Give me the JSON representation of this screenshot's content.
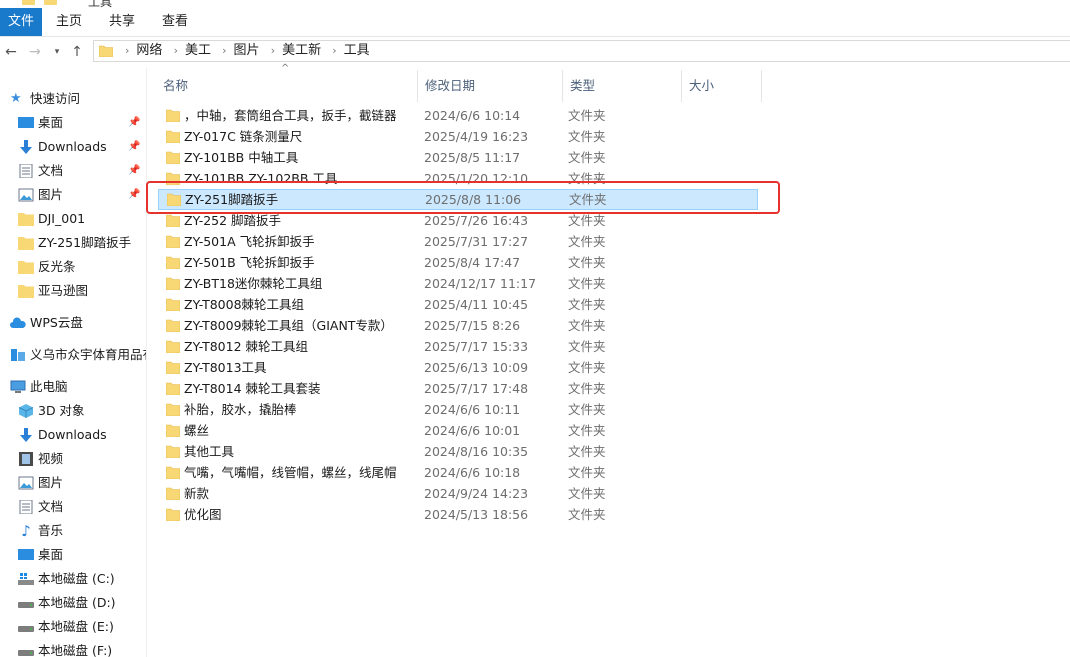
{
  "window": {
    "title": "工具"
  },
  "ribbon": {
    "tabs": [
      "文件",
      "主页",
      "共享",
      "查看"
    ]
  },
  "address": {
    "crumbs": [
      "网络",
      "美工",
      "图片",
      "美工新",
      "工具"
    ]
  },
  "sidebar": {
    "quick_access": "快速访问",
    "pinned": [
      "桌面",
      "Downloads",
      "文档",
      "图片"
    ],
    "recent": [
      "DJI_001",
      "ZY-251脚踏扳手",
      "反光条",
      "亚马逊图"
    ],
    "wps": "WPS云盘",
    "company": "义乌市众宇体育用品有",
    "this_pc": "此电脑",
    "pc_items": [
      "3D 对象",
      "Downloads",
      "视频",
      "图片",
      "文档",
      "音乐",
      "桌面",
      "本地磁盘 (C:)",
      "本地磁盘 (D:)",
      "本地磁盘 (E:)",
      "本地磁盘 (F:)"
    ]
  },
  "columns": {
    "name": "名称",
    "date": "修改日期",
    "type": "类型",
    "size": "大小"
  },
  "files": [
    {
      "name": "，中轴，套筒组合工具，扳手，截链器",
      "date": "2024/6/6 10:14",
      "type": "文件夹"
    },
    {
      "name": "ZY-017C  链条测量尺",
      "date": "2025/4/19 16:23",
      "type": "文件夹"
    },
    {
      "name": "ZY-101BB  中轴工具",
      "date": "2025/8/5 11:17",
      "type": "文件夹"
    },
    {
      "name": "ZY-101BB ZY-102BB  工具",
      "date": "2025/1/20 12:10",
      "type": "文件夹"
    },
    {
      "name": "ZY-251脚踏扳手",
      "date": "2025/8/8 11:06",
      "type": "文件夹",
      "selected": true
    },
    {
      "name": "ZY-252 脚踏扳手",
      "date": "2025/7/26 16:43",
      "type": "文件夹"
    },
    {
      "name": "ZY-501A  飞轮拆卸扳手",
      "date": "2025/7/31 17:27",
      "type": "文件夹"
    },
    {
      "name": "ZY-501B 飞轮拆卸扳手",
      "date": "2025/8/4 17:47",
      "type": "文件夹"
    },
    {
      "name": "ZY-BT18迷你棘轮工具组",
      "date": "2024/12/17 11:17",
      "type": "文件夹"
    },
    {
      "name": "ZY-T8008棘轮工具组",
      "date": "2025/4/11 10:45",
      "type": "文件夹"
    },
    {
      "name": "ZY-T8009棘轮工具组（GIANT专款）",
      "date": "2025/7/15 8:26",
      "type": "文件夹"
    },
    {
      "name": "ZY-T8012 棘轮工具组",
      "date": "2025/7/17 15:33",
      "type": "文件夹"
    },
    {
      "name": "ZY-T8013工具",
      "date": "2025/6/13 10:09",
      "type": "文件夹"
    },
    {
      "name": "ZY-T8014 棘轮工具套装",
      "date": "2025/7/17 17:48",
      "type": "文件夹"
    },
    {
      "name": "补胎，胶水，撬胎棒",
      "date": "2024/6/6 10:11",
      "type": "文件夹"
    },
    {
      "name": "螺丝",
      "date": "2024/6/6 10:01",
      "type": "文件夹"
    },
    {
      "name": "其他工具",
      "date": "2024/8/16 10:35",
      "type": "文件夹"
    },
    {
      "name": "气嘴，气嘴帽，线管帽，螺丝，线尾帽",
      "date": "2024/6/6 10:18",
      "type": "文件夹"
    },
    {
      "name": "新款",
      "date": "2024/9/24 14:23",
      "type": "文件夹"
    },
    {
      "name": "优化图",
      "date": "2024/5/13 18:56",
      "type": "文件夹"
    }
  ],
  "colors": {
    "accent": "#1979ca",
    "selection": "#cce8ff",
    "highlight": "#e5322d",
    "folder": "#f8d775"
  }
}
